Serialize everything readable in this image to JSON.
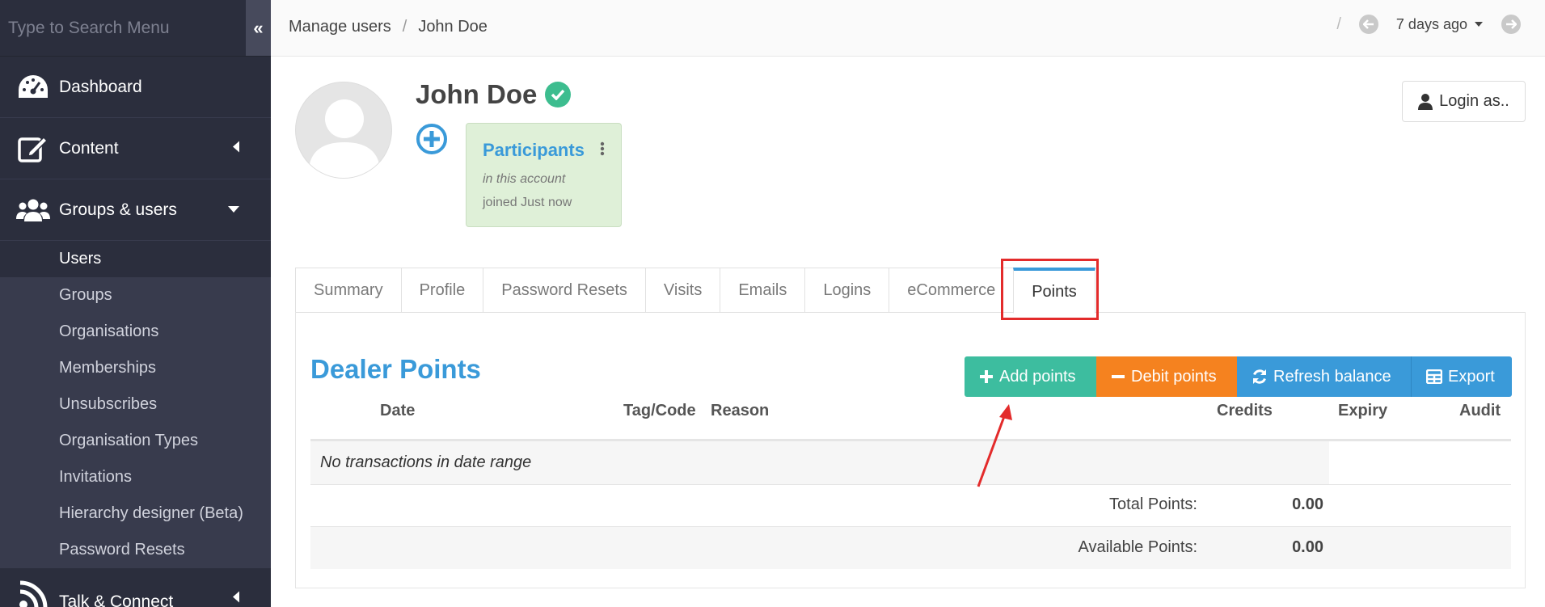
{
  "sidebar": {
    "search_placeholder": "Type to Search Menu",
    "collapse_icon": "«",
    "nav": [
      {
        "label": "Dashboard",
        "icon": "dashboard-icon"
      },
      {
        "label": "Content",
        "icon": "edit-icon"
      },
      {
        "label": "Groups & users",
        "icon": "users-icon"
      }
    ],
    "sub_items": [
      "Users",
      "Groups",
      "Organisations",
      "Memberships",
      "Unsubscribes",
      "Organisation Types",
      "Invitations",
      "Hierarchy designer (Beta)",
      "Password Resets"
    ],
    "bottom_nav": {
      "label": "Talk & Connect",
      "icon": "rss-icon"
    }
  },
  "topbar": {
    "breadcrumb_parent": "Manage users",
    "breadcrumb_sep": "/",
    "breadcrumb_current": "John Doe",
    "date_sep": "/",
    "date_range": "7 days ago"
  },
  "user": {
    "name": "John Doe",
    "login_as_label": "Login as.."
  },
  "group_card": {
    "title": "Participants",
    "subtitle": "in this account",
    "joined": "joined Just now"
  },
  "tabs": [
    "Summary",
    "Profile",
    "Password Resets",
    "Visits",
    "Emails",
    "Logins",
    "eCommerce",
    "Points"
  ],
  "active_tab": "Points",
  "points": {
    "title": "Dealer Points",
    "buttons": {
      "add": "Add points",
      "debit": "Debit points",
      "refresh": "Refresh balance",
      "export": "Export"
    },
    "columns": {
      "date": "Date",
      "tag": "Tag/Code",
      "reason": "Reason",
      "credits": "Credits",
      "expiry": "Expiry",
      "audit": "Audit"
    },
    "empty_message": "No transactions in date range",
    "total_label": "Total Points:",
    "total_value": "0.00",
    "available_label": "Available Points:",
    "available_value": "0.00"
  },
  "colors": {
    "sidebar_bg": "#383b4d",
    "accent_blue": "#3a9ad9",
    "add_green": "#3dbd9f",
    "debit_orange": "#f5821f",
    "highlight_red": "#e32b2b"
  }
}
